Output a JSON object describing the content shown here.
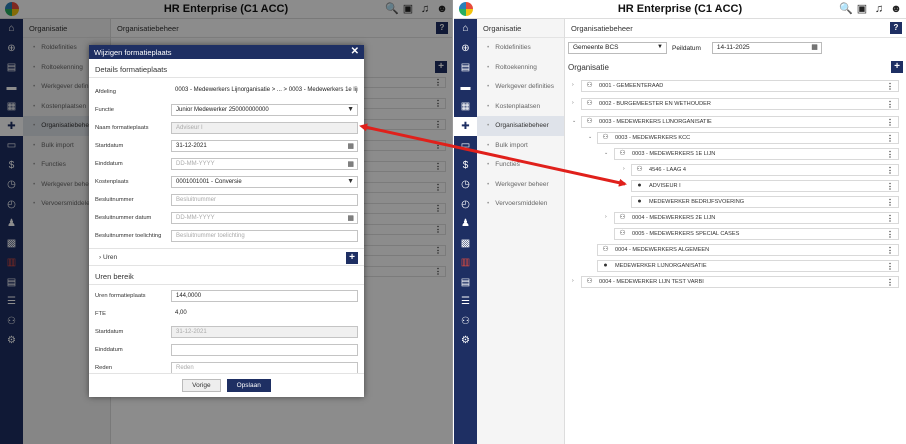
{
  "app_title": "HR Enterprise (C1 ACC)",
  "left": {
    "sidebar_title": "Organisatie",
    "sidebar_items": [
      "Roldefinities",
      "Roltoekenning",
      "Werkgever definities",
      "Kostenplaatsen",
      "Organisatiebeheer",
      "Bulk import",
      "Functies",
      "Werkgever beheer",
      "Vervoersmiddelen"
    ],
    "main_title": "Organisatiebeheer"
  },
  "modal": {
    "title": "Wijzigen formatieplaats",
    "section1": "Details formatieplaats",
    "afdeling_label": "Afdeling",
    "afdeling_value": "0003 - Medewerkers Lijnorganisatie > ... > 0003 - Medewerkers 1e lijn",
    "functie_label": "Functie",
    "functie_value": "Junior Medewerker 250000000000",
    "naam_label": "Naam formatieplaats",
    "naam_placeholder": "Adviseur I",
    "startdatum_label": "Startdatum",
    "startdatum_value": "31-12-2021",
    "einddatum_label": "Einddatum",
    "einddatum_placeholder": "DD-MM-YYYY",
    "kostenplaats_label": "Kostenplaats",
    "kostenplaats_value": "0001001001 - Conversie",
    "besluitnummer_label": "Besluitnummer",
    "besluitnummer_placeholder": "Besluitnummer",
    "besluitdatum_label": "Besluitnummer datum",
    "besluitdatum_placeholder": "DD-MM-YYYY",
    "toelichting_label": "Besluitnummer toelichting",
    "toelichting_placeholder": "Besluitnummer toelichting",
    "uren_collapse": "Uren",
    "section2": "Uren bereik",
    "uren_label": "Uren formatieplaats",
    "uren_value": "144,0000",
    "fte_label": "FTE",
    "fte_value": "4,00",
    "startdatum2_label": "Startdatum",
    "startdatum2_value": "31-12-2021",
    "einddatum2_label": "Einddatum",
    "reden_label": "Reden",
    "reden_placeholder": "Reden",
    "btn_prev": "Vorige",
    "btn_save": "Opslaan"
  },
  "right": {
    "sidebar_title": "Organisatie",
    "sidebar_items": [
      "Roldefinities",
      "Roltoekenning",
      "Werkgever definities",
      "Kostenplaatsen",
      "Organisatiebeheer",
      "Bulk import",
      "Functies",
      "Werkgever beheer",
      "Vervoersmiddelen"
    ],
    "main_title": "Organisatiebeheer",
    "gemeente": "Gemeente BCS",
    "peildatum_label": "Peildatum",
    "peildatum_value": "14-11-2025",
    "tree_title": "Organisatie",
    "tree": [
      "0001 - GEMEENTERAAD",
      "0002 - BURGEMEESTER EN WETHOUDER",
      "0003 - MEDEWERKERS LIJNORGANISATIE",
      "0003 - MEDEWERKERS KCC",
      "0003 - MEDEWERKERS 1E LIJN",
      "4546 - LAAG 4",
      "ADVISEUR I",
      "MEDEWERKER BEDRIJFSVOERING",
      "0004 - MEDEWERKERS 2E LIJN",
      "0005 - MEDEWERKERS SPECIAL CASES",
      "0004 - MEDEWERKERS ALGEMEEN",
      "MEDEWERKER LIJNORGANISATIE",
      "0004 - MEDEWERKER LIJN TEST VARBI"
    ]
  },
  "colors": {
    "navy": "#1e2f63",
    "arrow": "#e0201b"
  }
}
